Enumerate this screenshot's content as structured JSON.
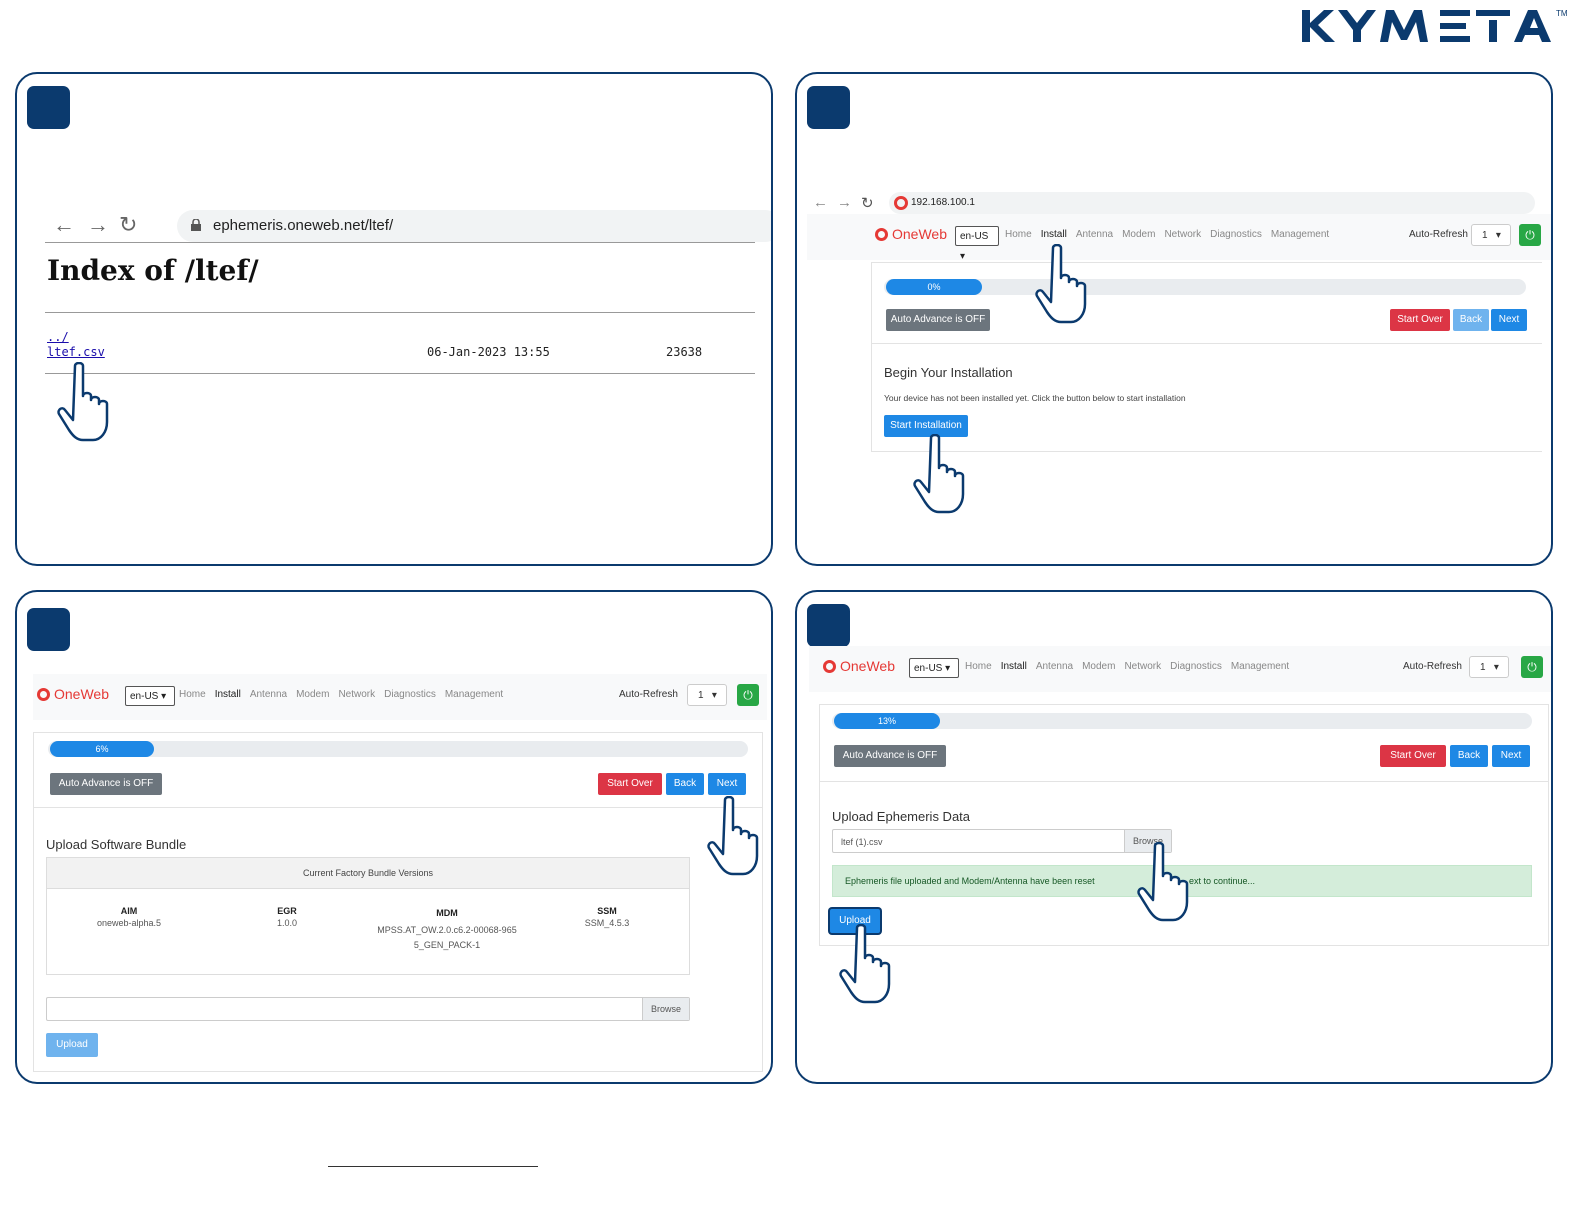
{
  "brand": {
    "logo_text": "KYMETA",
    "trademark": "TM"
  },
  "panel1": {
    "url": "ephemeris.oneweb.net/ltef/",
    "heading": "Index of /ltef/",
    "parent_link": "../",
    "file": {
      "name": "ltef.csv",
      "date": "06-Jan-2023 13:55",
      "size": "23638"
    }
  },
  "panel2": {
    "url": "192.168.100.1",
    "nav": {
      "brand": "OneWeb",
      "lang": "en-US",
      "menu": [
        "Home",
        "Install",
        "Antenna",
        "Modem",
        "Network",
        "Diagnostics",
        "Management"
      ],
      "auto_refresh_label": "Auto-Refresh",
      "auto_refresh_value": "1"
    },
    "progress": {
      "label": "0%",
      "percent": 0
    },
    "buttons": {
      "auto_advance": "Auto Advance is OFF",
      "start_over": "Start Over",
      "back": "Back",
      "next": "Next"
    },
    "heading": "Begin Your Installation",
    "text": "Your device has not been installed yet. Click the button below to start installation",
    "start_button": "Start Installation"
  },
  "panel3": {
    "nav": {
      "brand": "OneWeb",
      "lang": "en-US",
      "menu": [
        "Home",
        "Install",
        "Antenna",
        "Modem",
        "Network",
        "Diagnostics",
        "Management"
      ],
      "auto_refresh_label": "Auto-Refresh",
      "auto_refresh_value": "1"
    },
    "progress": {
      "label": "6%",
      "percent": 6
    },
    "buttons": {
      "auto_advance": "Auto Advance is OFF",
      "start_over": "Start Over",
      "back": "Back",
      "next": "Next"
    },
    "heading": "Upload Software Bundle",
    "table_title": "Current Factory Bundle Versions",
    "columns": [
      {
        "name": "AIM",
        "value": "oneweb-alpha.5"
      },
      {
        "name": "EGR",
        "value": "1.0.0"
      },
      {
        "name": "MDM",
        "value": "MPSS.AT_OW.2.0.c6.2-00068-9655_GEN_PACK-1"
      },
      {
        "name": "SSM",
        "value": "SSM_4.5.3"
      }
    ],
    "file_value": "",
    "browse": "Browse",
    "upload": "Upload"
  },
  "panel4": {
    "nav": {
      "brand": "OneWeb",
      "lang": "en-US",
      "menu": [
        "Home",
        "Install",
        "Antenna",
        "Modem",
        "Network",
        "Diagnostics",
        "Management"
      ],
      "auto_refresh_label": "Auto-Refresh",
      "auto_refresh_value": "1"
    },
    "progress": {
      "label": "13%",
      "percent": 13
    },
    "buttons": {
      "auto_advance": "Auto Advance is OFF",
      "start_over": "Start Over",
      "back": "Back",
      "next": "Next"
    },
    "heading": "Upload Ephemeris Data",
    "file_value": "ltef (1).csv",
    "browse": "Browse",
    "alert_left": "Ephemeris file uploaded and Modem/Antenna have been reset",
    "alert_right": "ext to continue...",
    "upload": "Upload"
  }
}
